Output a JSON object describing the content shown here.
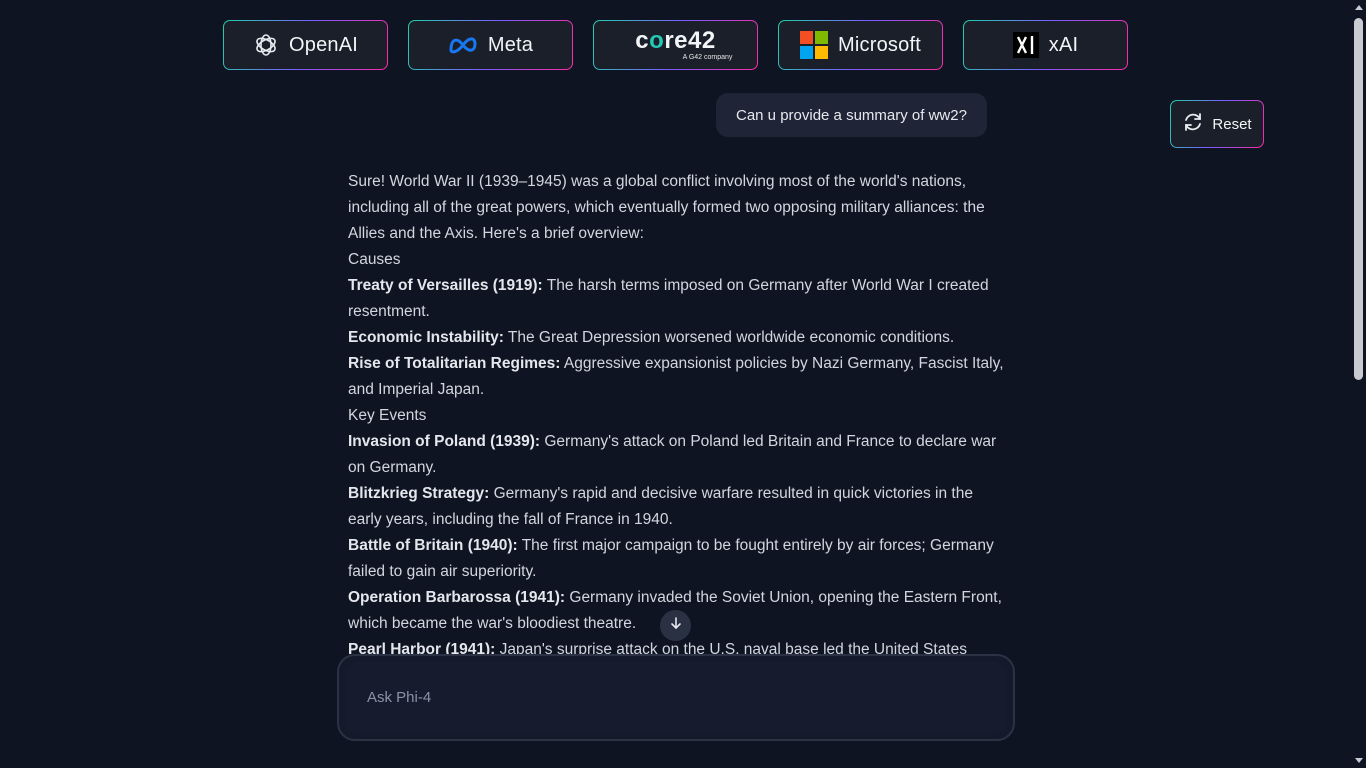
{
  "providers": [
    {
      "label": "OpenAI",
      "icon": "openai-icon"
    },
    {
      "label": "Meta",
      "icon": "meta-icon"
    },
    {
      "label": "core42",
      "tagline": "A G42 company",
      "icon": "core42-logo"
    },
    {
      "label": "Microsoft",
      "icon": "microsoft-icon"
    },
    {
      "label": "xAI",
      "icon": "xai-icon"
    }
  ],
  "reset": {
    "label": "Reset",
    "icon": "refresh-icon"
  },
  "user_message": "Can u provide a summary of ww2?",
  "response": {
    "intro": "Sure! World War II (1939–1945) was a global conflict involving most of the world's nations, including all of the great powers, which eventually formed two opposing military alliances: the Allies and the Axis. Here's a brief overview:",
    "sections": [
      {
        "heading": "Causes",
        "items": [
          {
            "term": "Treaty of Versailles (1919):",
            "text": " The harsh terms imposed on Germany after World War I created resentment."
          },
          {
            "term": "Economic Instability:",
            "text": " The Great Depression worsened worldwide economic conditions."
          },
          {
            "term": "Rise of Totalitarian Regimes:",
            "text": " Aggressive expansionist policies by Nazi Germany, Fascist Italy, and Imperial Japan."
          }
        ]
      },
      {
        "heading": "Key Events",
        "items": [
          {
            "term": "Invasion of Poland (1939):",
            "text": " Germany's attack on Poland led Britain and France to declare war on Germany."
          },
          {
            "term": "Blitzkrieg Strategy:",
            "text": " Germany's rapid and decisive warfare resulted in quick victories in the early years, including the fall of France in 1940."
          },
          {
            "term": "Battle of Britain (1940):",
            "text": " The first major campaign to be fought entirely by air forces; Germany failed to gain air superiority."
          },
          {
            "term": "Operation Barbarossa (1941):",
            "text": " Germany invaded the Soviet Union, opening the Eastern Front, which became the war's bloodiest theatre."
          },
          {
            "term": "Pearl Harbor (1941):",
            "text": " Japan's surprise attack on the U.S. naval base led the United States"
          }
        ]
      }
    ]
  },
  "input": {
    "placeholder": "Ask Phi-4",
    "value": ""
  },
  "colors": {
    "background": "#0f1423",
    "border_gradient_start": "#1fd1a8",
    "border_gradient_end": "#ff2aa6",
    "teal_accent": "#23c9b3"
  }
}
